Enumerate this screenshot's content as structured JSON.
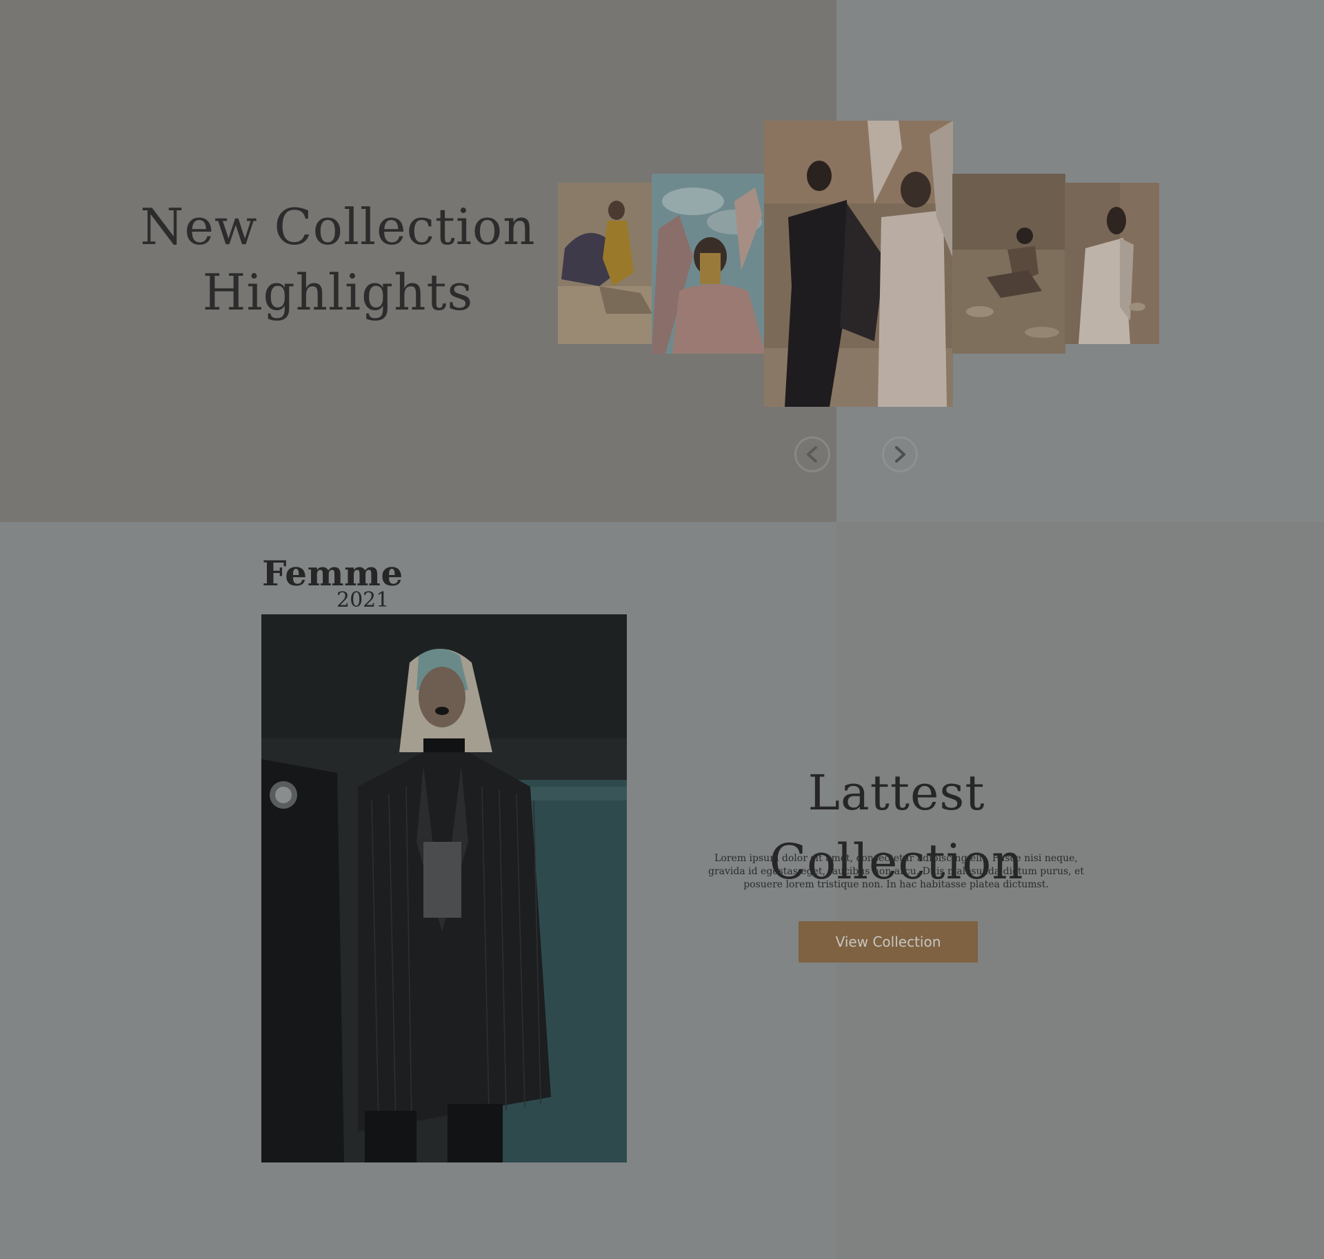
{
  "hero": {
    "title_line1": "New Collection",
    "title_line2": "Highlights",
    "background_left": "#777672",
    "background_right": "#838687"
  },
  "carousel": {
    "slides": [
      {
        "description": "model reclining in yellow fringe dress"
      },
      {
        "description": "model with gold face chain and pink coat"
      },
      {
        "description": "two models in black jumpsuit and white dress"
      },
      {
        "description": "model kneeling on rocky ground"
      },
      {
        "description": "model in white dress looking up"
      }
    ],
    "prev_icon": "chevron-left-icon",
    "next_icon": "chevron-right-icon"
  },
  "feature": {
    "brand": "Femme",
    "year": "2021",
    "title": "Lattest Collection",
    "description": "Lorem ipsum dolor sit amet, consectetur adipiscing elit. Fusce nisi neque, gravida id egestas eget, faucibus non arcu. Duis malesuada dictum purus, et posuere lorem tristique non. In hac habitasse platea dictumst.",
    "button_label": "View Collection",
    "accent_color": "#7e6242"
  }
}
